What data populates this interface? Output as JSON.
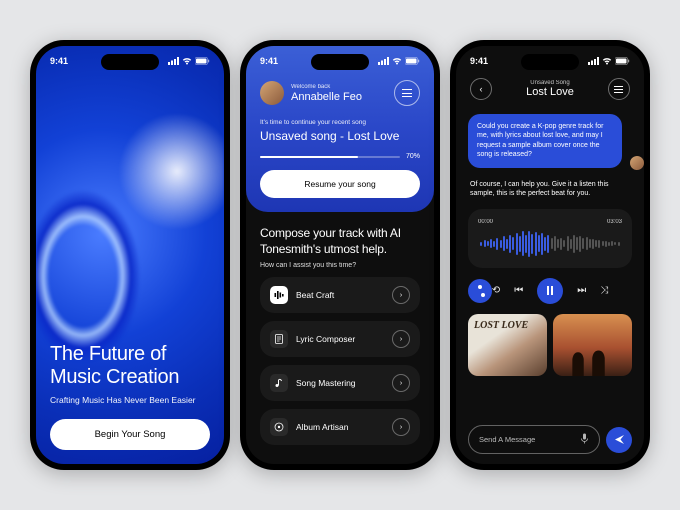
{
  "status": {
    "time": "9:41"
  },
  "screen1": {
    "title_l1": "The Future of",
    "title_l2": "Music Creation",
    "subtitle": "Crafting Music Has Never Been Easier",
    "cta": "Begin Your Song"
  },
  "screen2": {
    "welcome": "Welcome back",
    "username": "Annabelle Feo",
    "continue_hint": "It's time to continue your recent song",
    "song_title": "Unsaved song - Lost Love",
    "progress_pct": "70%",
    "resume_label": "Resume your song",
    "compose_l1": "Compose your track with AI",
    "compose_l2": "Tonesmith's utmost help.",
    "assist_prompt": "How can I assist you this time?",
    "tools": [
      {
        "label": "Beat Craft"
      },
      {
        "label": "Lyric Composer"
      },
      {
        "label": "Song Mastering"
      },
      {
        "label": "Album Artisan"
      }
    ]
  },
  "screen3": {
    "pretitle": "Unsaved Song",
    "title": "Lost Love",
    "user_message": "Could you create a K-pop genre track for me, with lyrics about lost love, and may I request a sample album cover once the song is released?",
    "ai_message": "Of course, I can help you. Give it a listen this sample, this is the perfect beat for you.",
    "time_start": "00:00",
    "time_end": "03:03",
    "cover1_text": "LOST LOVE",
    "input_placeholder": "Send A Message"
  }
}
